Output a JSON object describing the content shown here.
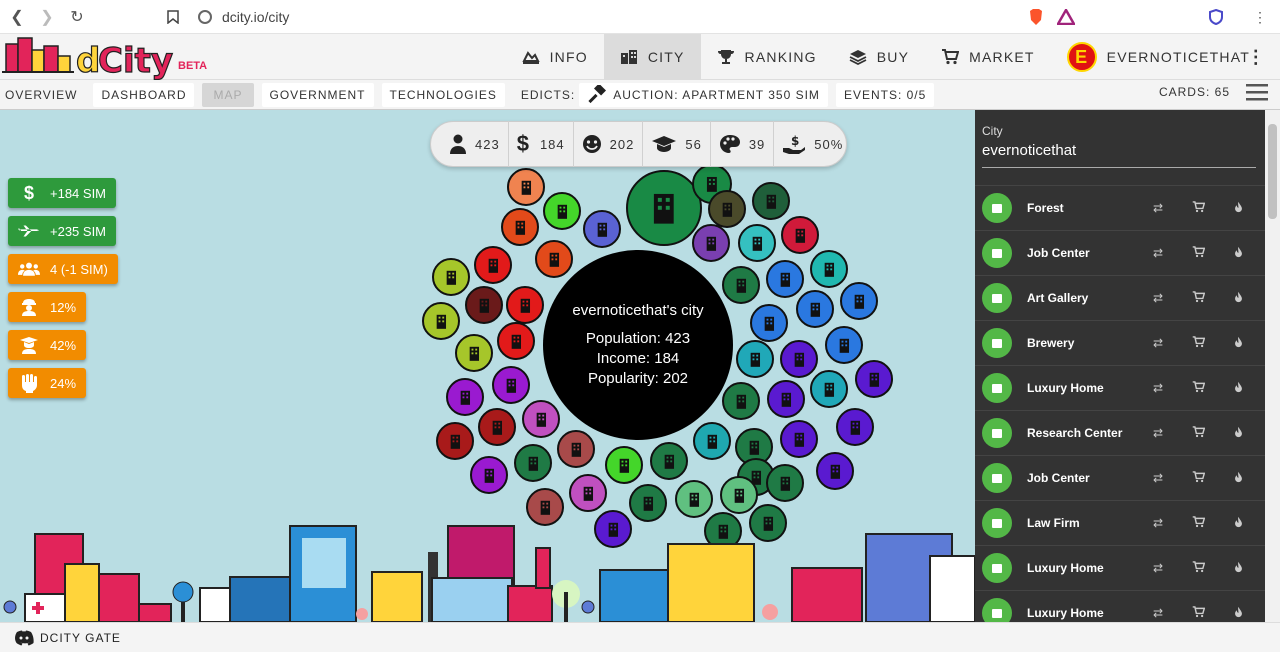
{
  "browser": {
    "url": "dcity.io/city"
  },
  "header": {
    "brand": "dCity",
    "brand_tag": "BETA",
    "nav": [
      {
        "label": "INFO",
        "icon": "info-icon"
      },
      {
        "label": "CITY",
        "icon": "city-icon",
        "active": true
      },
      {
        "label": "RANKING",
        "icon": "trophy-icon"
      },
      {
        "label": "BUY",
        "icon": "layers-icon"
      },
      {
        "label": "MARKET",
        "icon": "cart-icon"
      }
    ],
    "user": {
      "initial": "E",
      "name": "EVERNOTICETHAT"
    }
  },
  "toolbar": {
    "overview": "OVERVIEW",
    "dashboard": "DASHBOARD",
    "map": "MAP",
    "government": "GOVERNMENT",
    "technologies": "TECHNOLOGIES",
    "edicts": "EDICTS:",
    "auction": "AUCTION: APARTMENT 350 SIM",
    "events": "EVENTS: 0/5",
    "cards": "CARDS: 65"
  },
  "stats_bar": {
    "population": "423",
    "income": "184",
    "popularity": "202",
    "education": "56",
    "creativity": "39",
    "tax": "50%"
  },
  "left_stats": [
    {
      "icon": "dollar-icon",
      "text": "+184 SIM",
      "color": "#2e9a3c"
    },
    {
      "icon": "airplane-icon",
      "text": "+235 SIM",
      "color": "#2e9a3c"
    },
    {
      "icon": "users-icon",
      "text": "4 (-1 SIM)",
      "color": "#f28c00"
    },
    {
      "icon": "crime-icon",
      "text": "12%",
      "color": "#f28c00"
    },
    {
      "icon": "education-icon",
      "text": "42%",
      "color": "#f28c00"
    },
    {
      "icon": "fist-icon",
      "text": "24%",
      "color": "#f28c00"
    }
  ],
  "city_center": {
    "title": "evernoticethat's city",
    "population": "Population: 423",
    "income": "Income: 184",
    "popularity": "Popularity: 202"
  },
  "sidebar": {
    "city_label": "City",
    "city_value": "evernoticethat",
    "cards": [
      {
        "name": "Forest",
        "icon": "tree-icon"
      },
      {
        "name": "Job Center",
        "icon": "briefcase-icon"
      },
      {
        "name": "Art Gallery",
        "icon": "picture-icon"
      },
      {
        "name": "Brewery",
        "icon": "beer-icon"
      },
      {
        "name": "Luxury Home",
        "icon": "building-icon"
      },
      {
        "name": "Research Center",
        "icon": "gear-icon"
      },
      {
        "name": "Job Center",
        "icon": "briefcase-icon"
      },
      {
        "name": "Law Firm",
        "icon": "scale-icon"
      },
      {
        "name": "Luxury Home",
        "icon": "building-icon"
      },
      {
        "name": "Luxury Home",
        "icon": "building-icon"
      }
    ]
  },
  "footer": {
    "label": "DCITY GATE"
  },
  "colors": {
    "sidebar_bg": "#333333",
    "card_icon": "#53b847",
    "map_bg": "#b9dde3",
    "positive": "#2e9a3c",
    "warning": "#f28c00"
  }
}
